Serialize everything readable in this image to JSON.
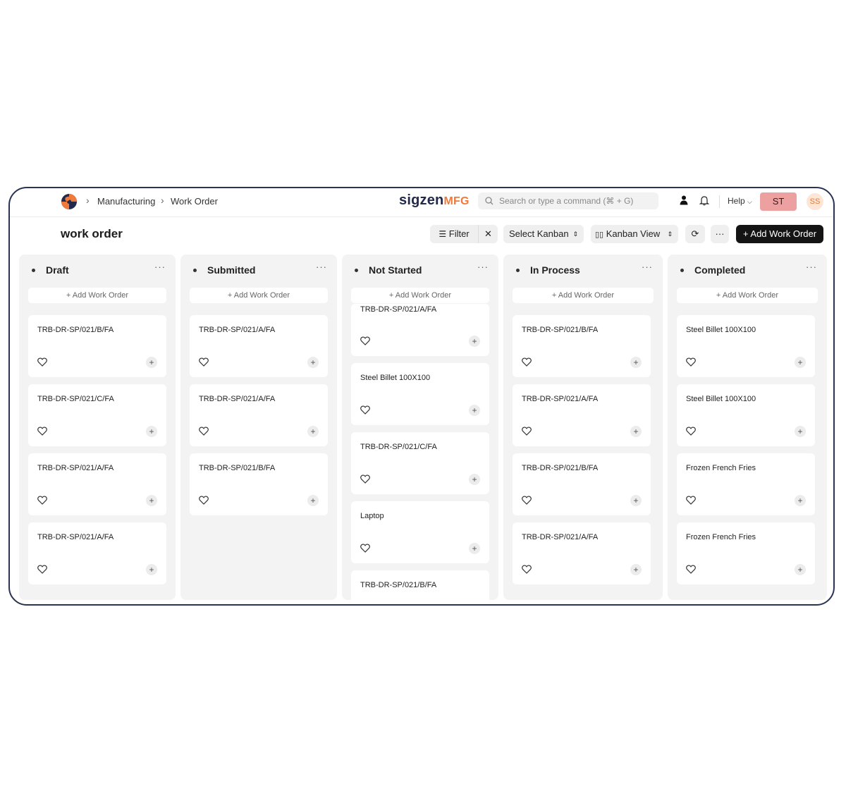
{
  "breadcrumb": {
    "items": [
      "Manufacturing",
      "Work Order"
    ]
  },
  "brand": {
    "part1": "sigzen",
    "part2": "MFG"
  },
  "search": {
    "placeholder": "Search or type a command (⌘ + G)"
  },
  "navbar": {
    "help_label": "Help",
    "user_initials": "ST",
    "avatar_initials": "SS"
  },
  "page": {
    "title": "work order"
  },
  "toolbar": {
    "filter_label": "Filter",
    "select_kanban_label": "Select Kanban",
    "view_label": "Kanban View",
    "more_label": "···",
    "add_label": "+ Add Work Order"
  },
  "colors": {
    "accent": "#f07a3a",
    "brand_dark": "#23294a",
    "user_badge": "#eda0a0"
  },
  "columns": [
    {
      "title": "Draft",
      "add_label": "+ Add Work Order",
      "cards": [
        "TRB-DR-SP/021/B/FA",
        "TRB-DR-SP/021/C/FA",
        "TRB-DR-SP/021/A/FA",
        "TRB-DR-SP/021/A/FA"
      ]
    },
    {
      "title": "Submitted",
      "add_label": "+ Add Work Order",
      "cards": [
        "TRB-DR-SP/021/A/FA",
        "TRB-DR-SP/021/A/FA",
        "TRB-DR-SP/021/B/FA"
      ]
    },
    {
      "title": "Not Started",
      "add_label": "+ Add Work Order",
      "cards": [
        "TRB-DR-SP/021/A/FA",
        "Steel Billet 100X100",
        "TRB-DR-SP/021/C/FA",
        "Laptop",
        "TRB-DR-SP/021/B/FA"
      ]
    },
    {
      "title": "In Process",
      "add_label": "+ Add Work Order",
      "cards": [
        "TRB-DR-SP/021/B/FA",
        "TRB-DR-SP/021/A/FA",
        "TRB-DR-SP/021/B/FA",
        "TRB-DR-SP/021/A/FA"
      ]
    },
    {
      "title": "Completed",
      "add_label": "+ Add Work Order",
      "cards": [
        "Steel Billet 100X100",
        "Steel Billet 100X100",
        "Frozen French Fries",
        "Frozen French Fries"
      ]
    }
  ],
  "card_common": {
    "more": "···",
    "plus": "+"
  },
  "icons": {
    "heart": "heart-icon",
    "plus": "plus-icon",
    "search": "search-icon",
    "bell": "bell-icon",
    "user": "user-icon"
  }
}
